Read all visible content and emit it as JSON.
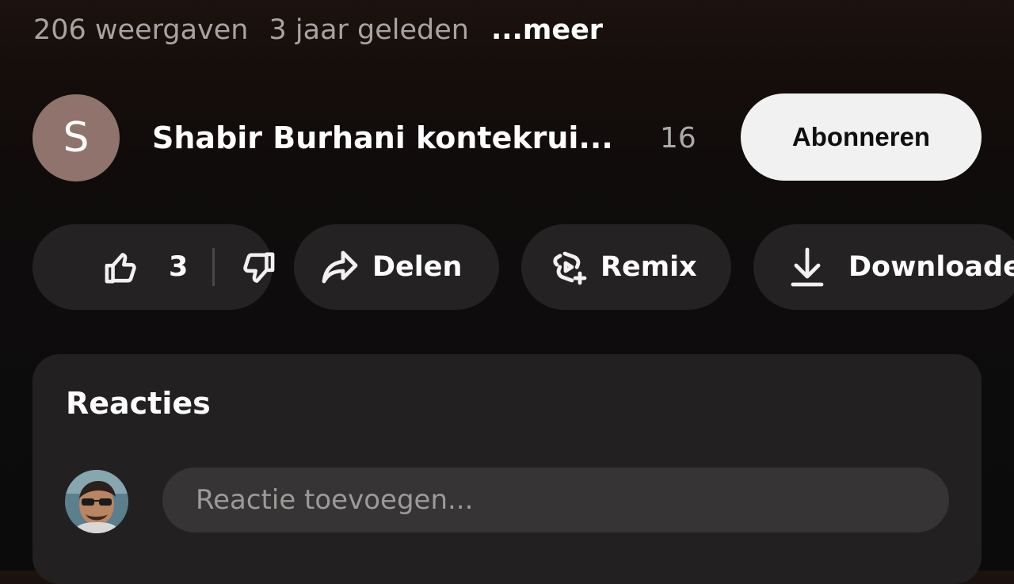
{
  "video": {
    "views": "206 weergaven",
    "age": "3 jaar geleden",
    "more": "...meer"
  },
  "channel": {
    "avatar_letter": "S",
    "avatar_color": "#8f736c",
    "name": "Shabir Burhani kontekrui...",
    "subscriber_count": "16",
    "subscribe_label": "Abonneren"
  },
  "actions": {
    "like_count": "3",
    "like_icon": "thumbs-up-icon",
    "dislike_icon": "thumbs-down-icon",
    "share_label": "Delen",
    "share_icon": "share-arrow-icon",
    "remix_label": "Remix",
    "remix_icon": "remix-icon",
    "download_label": "Downloaden",
    "download_icon": "download-icon"
  },
  "comments": {
    "title": "Reacties",
    "input_placeholder": "Reactie toevoegen..."
  },
  "colors": {
    "subscribe_bg": "#f1f1f1",
    "pill_bg": "#242222",
    "panel_bg": "#222020"
  }
}
